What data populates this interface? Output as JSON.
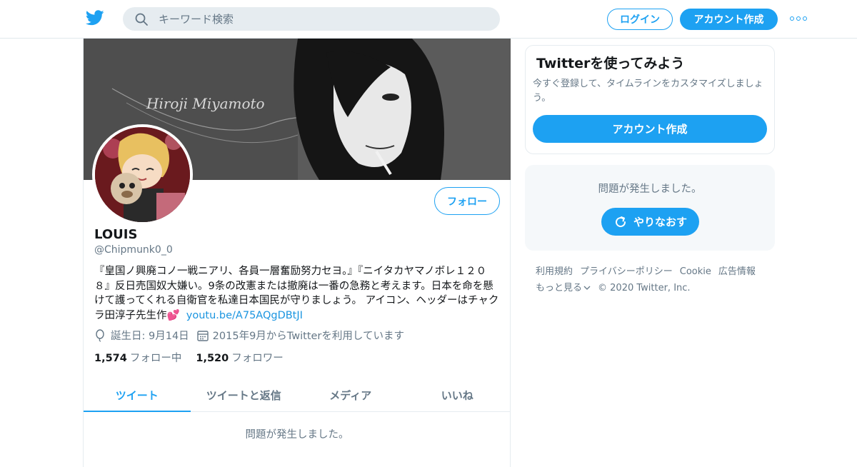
{
  "header": {
    "search_placeholder": "キーワード検索",
    "login_label": "ログイン",
    "signup_label": "アカウント作成"
  },
  "profile": {
    "banner_text": "Hiroji Miyamoto",
    "name": "LOUIS",
    "handle": "@Chipmunk0_0",
    "follow_label": "フォロー",
    "bio": "『皇国ノ興廃コノ一戦ニアリ、各員一層奮励努力セヨ。』『ニイタカヤマノボレ１２０８』反日売国奴大嫌い。9条の改憲または撤廃は一番の急務と考えます。日本を命を懸けて護ってくれる自衛官を私達日本国民が守りましょう。 アイコン、ヘッダーはチャクラ田淳子先生作💕",
    "bio_link": "youtu.be/A75AQgDBtJI",
    "birthday": "誕生日: 9月14日",
    "joined": "2015年9月からTwitterを利用しています",
    "following_count": "1,574",
    "following_label": "フォロー中",
    "followers_count": "1,520",
    "followers_label": "フォロワー"
  },
  "tabs": [
    {
      "label": "ツイート",
      "active": true
    },
    {
      "label": "ツイートと返信",
      "active": false
    },
    {
      "label": "メディア",
      "active": false
    },
    {
      "label": "いいね",
      "active": false
    }
  ],
  "timeline": {
    "error": "問題が発生しました。"
  },
  "sidebar": {
    "promo_title": "Twitterを使ってみよう",
    "promo_text": "今すぐ登録して、タイムラインをカスタマイズしましょう。",
    "promo_button": "アカウント作成",
    "error_text": "問題が発生しました。",
    "retry_label": "やりなおす"
  },
  "footer": {
    "links": [
      "利用規約",
      "プライバシーポリシー",
      "Cookie",
      "広告情報",
      "もっと見る"
    ],
    "copyright": "© 2020 Twitter, Inc."
  },
  "colors": {
    "accent": "#1da1f2",
    "text_secondary": "#657786",
    "border": "#e6ecf0"
  }
}
